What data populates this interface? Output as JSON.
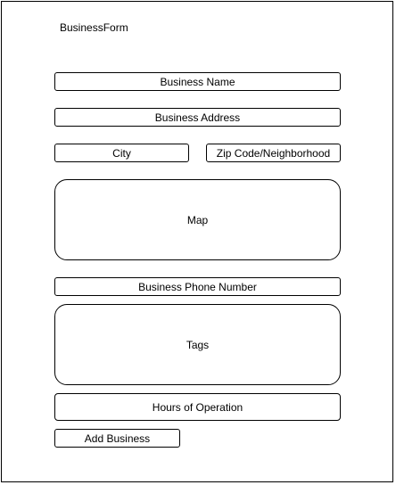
{
  "form": {
    "title": "BusinessForm",
    "fields": {
      "business_name": "Business Name",
      "business_address": "Business Address",
      "city": "City",
      "zip_code": "Zip Code/Neighborhood",
      "map": "Map",
      "phone": "Business Phone Number",
      "tags": "Tags",
      "hours": "Hours of Operation"
    },
    "submit_label": "Add Business"
  }
}
